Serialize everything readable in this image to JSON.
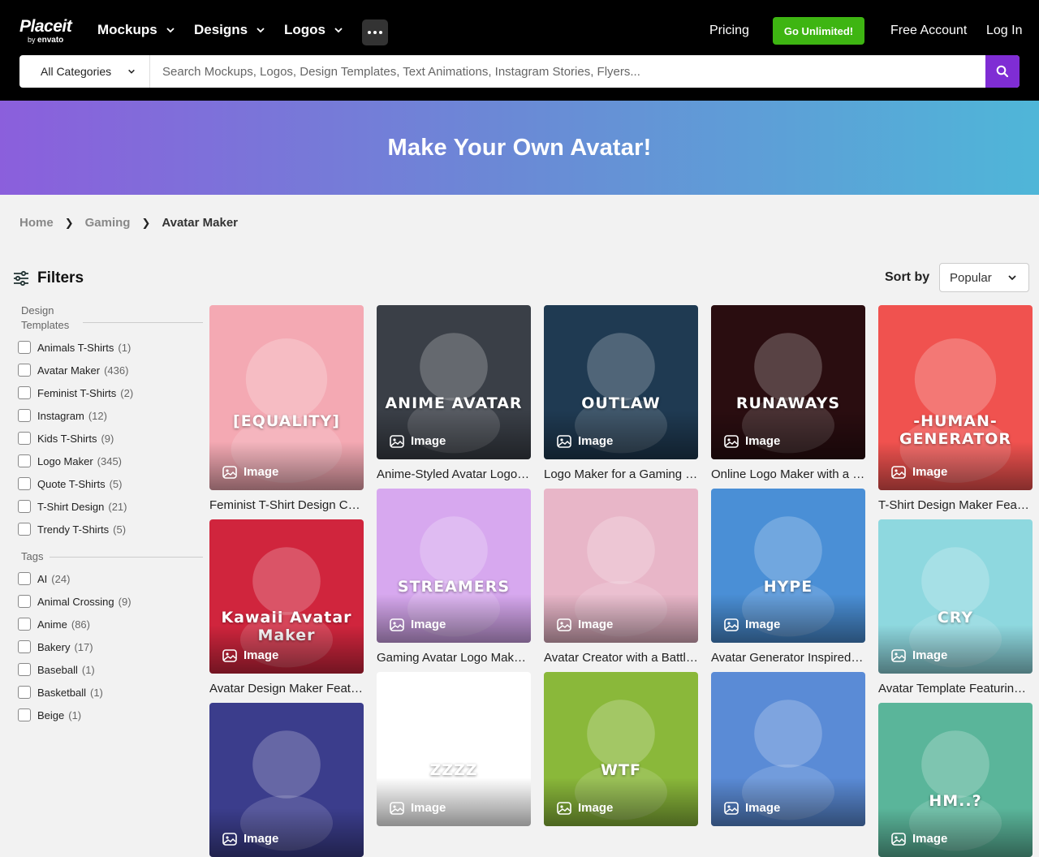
{
  "header": {
    "logo_main": "Placeit",
    "logo_by": "by",
    "logo_brand": "envato",
    "nav": [
      {
        "label": "Mockups"
      },
      {
        "label": "Designs"
      },
      {
        "label": "Logos"
      }
    ],
    "pricing": "Pricing",
    "unlimited": "Go Unlimited!",
    "free_account": "Free Account",
    "login": "Log In"
  },
  "search": {
    "category": "All Categories",
    "placeholder": "Search Mockups, Logos, Design Templates, Text Animations, Instagram Stories, Flyers..."
  },
  "hero": {
    "title": "Make Your Own Avatar!"
  },
  "breadcrumb": [
    {
      "label": "Home"
    },
    {
      "label": "Gaming"
    },
    {
      "label": "Avatar Maker"
    }
  ],
  "filters": {
    "title": "Filters",
    "groups": [
      {
        "title": "Design Templates",
        "items": [
          {
            "label": "Animals T-Shirts",
            "count": "(1)"
          },
          {
            "label": "Avatar Maker",
            "count": "(436)"
          },
          {
            "label": "Feminist T-Shirts",
            "count": "(2)"
          },
          {
            "label": "Instagram",
            "count": "(12)"
          },
          {
            "label": "Kids T-Shirts",
            "count": "(9)"
          },
          {
            "label": "Logo Maker",
            "count": "(345)"
          },
          {
            "label": "Quote T-Shirts",
            "count": "(5)"
          },
          {
            "label": "T-Shirt Design",
            "count": "(21)"
          },
          {
            "label": "Trendy T-Shirts",
            "count": "(5)"
          }
        ]
      },
      {
        "title": "Tags",
        "items": [
          {
            "label": "AI",
            "count": "(24)"
          },
          {
            "label": "Animal Crossing",
            "count": "(9)"
          },
          {
            "label": "Anime",
            "count": "(86)"
          },
          {
            "label": "Bakery",
            "count": "(17)"
          },
          {
            "label": "Baseball",
            "count": "(1)"
          },
          {
            "label": "Basketball",
            "count": "(1)"
          },
          {
            "label": "Beige",
            "count": "(1)"
          }
        ]
      }
    ]
  },
  "sort": {
    "label": "Sort by",
    "value": "Popular"
  },
  "badge_label": "Image",
  "cards": [
    {
      "title": "Feminist T-Shirt Design Creator with an Equality Quote",
      "art_text": "[EQUALITY]",
      "bg": "#f4a9b3"
    },
    {
      "title": "Anime-Styled Avatar Logo Maker for a Twitch Streamer",
      "art_text": "ANIME AVATAR",
      "bg": "#3a3f47"
    },
    {
      "title": "Logo Maker for a Gaming Squad with an Outlaw Avatar",
      "art_text": "OUTLAW",
      "bg": "#1f3a52"
    },
    {
      "title": "Online Logo Maker with a Runaways E-Sports Avatar",
      "art_text": "RUNAWAYS",
      "bg": "#2a0d10"
    },
    {
      "title": "T-Shirt Design Maker Featuring a Human Generator Graphic",
      "art_text": "-HUMAN- GENERATOR",
      "bg": "#f0524f"
    },
    {
      "title": "Avatar Design Maker Featuring a Kawaii Girl",
      "art_text": "Kawaii Avatar Maker",
      "bg": "#d0253d"
    },
    {
      "title": "Gaming Avatar Logo Maker for Streamers",
      "art_text": "STREAMERS",
      "bg": "#d7a8ef"
    },
    {
      "title": "Avatar Creator with a Battle Cat Illustration",
      "art_text": "",
      "bg": "#e8b6c8"
    },
    {
      "title": "Avatar Generator Inspired by Hype Cat Memes",
      "art_text": "HYPE",
      "bg": "#4a8fd6"
    },
    {
      "title": "Avatar Template Featuring a Crying Cat",
      "art_text": "CRY",
      "bg": "#8ed8df"
    },
    {
      "title": "",
      "art_text": "",
      "bg": "#3b3d8c"
    },
    {
      "title": "",
      "art_text": "ZZZZ",
      "bg": "#ffffff"
    },
    {
      "title": "",
      "art_text": "WTF",
      "bg": "#8ab83a"
    },
    {
      "title": "",
      "art_text": "",
      "bg": "#5a8bd6"
    },
    {
      "title": "",
      "art_text": "HM..?",
      "bg": "#5ab59a"
    }
  ]
}
